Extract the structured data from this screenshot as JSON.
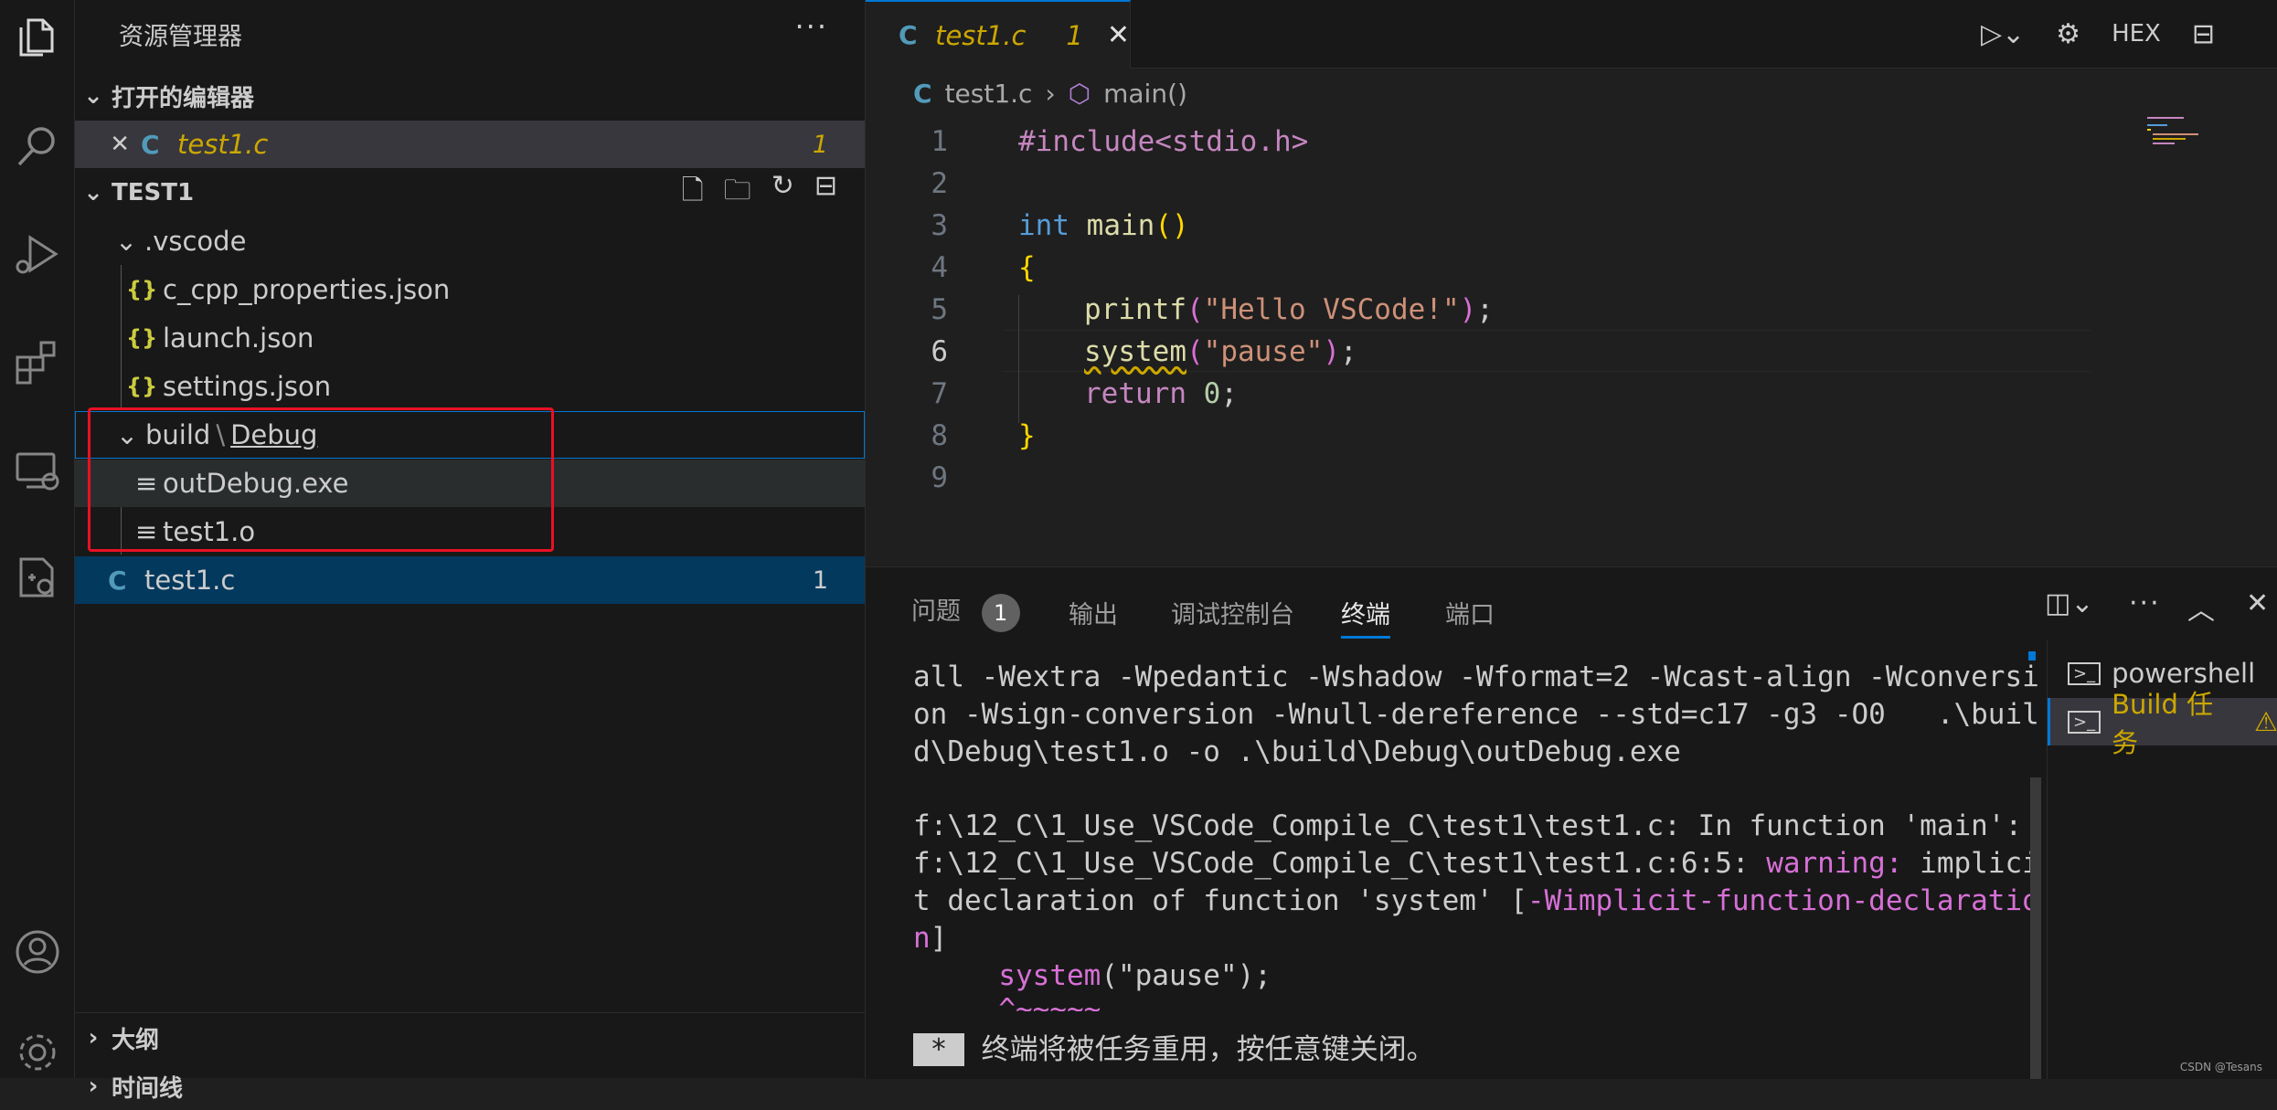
{
  "sidebar": {
    "title": "资源管理器",
    "more": "···",
    "open_editors": {
      "label": "打开的编辑器",
      "file": "test1.c",
      "badge": "1"
    },
    "project": {
      "label": "TEST1"
    },
    "tree": {
      "vscode_folder": ".vscode",
      "files": [
        "c_cpp_properties.json",
        "launch.json",
        "settings.json"
      ],
      "build_folder": "build",
      "build_sep": "\\",
      "build_sub": "Debug",
      "build_files": [
        "outDebug.exe",
        "test1.o"
      ],
      "root_file": "test1.c",
      "root_badge": "1"
    },
    "outline": "大纲",
    "timeline": "时间线"
  },
  "editor": {
    "tab": {
      "name": "test1.c",
      "badge": "1",
      "close": "✕"
    },
    "hex": "HEX",
    "breadcrumb": {
      "file": "test1.c",
      "symbol": "main()"
    },
    "line_numbers": [
      "1",
      "2",
      "3",
      "4",
      "5",
      "6",
      "7",
      "8",
      "9"
    ],
    "code": {
      "l1": "#include<stdio.h>",
      "l3_kw": "int",
      "l3_fn": "main",
      "l3_parens": "()",
      "l4": "{",
      "l5_fn": "printf",
      "l5_open": "(",
      "l5_str": "\"Hello VSCode!\"",
      "l5_close": ")",
      "l5_semi": ";",
      "l6_fn": "system",
      "l6_open": "(",
      "l6_str": "\"pause\"",
      "l6_close": ")",
      "l6_semi": ";",
      "l7_kw": "return",
      "l7_num": "0",
      "l7_semi": ";",
      "l8": "}"
    }
  },
  "panel": {
    "tabs": {
      "problems": "问题",
      "problems_count": "1",
      "output": "输出",
      "debug_console": "调试控制台",
      "terminal": "终端",
      "ports": "端口"
    },
    "terminal_lines": {
      "t1": "all -Wextra -Wpedantic -Wshadow -Wformat=2 -Wcast-align -Wconversi",
      "t2": "on -Wsign-conversion -Wnull-dereference --std=c17 -g3 -O0   .\\buil",
      "t3": "d\\Debug\\test1.o -o .\\build\\Debug\\outDebug.exe",
      "t4": "f:\\12_C\\1_Use_VSCode_Compile_C\\test1\\test1.c: In function 'main':",
      "t5a": "f:\\12_C\\1_Use_VSCode_Compile_C\\test1\\test1.c:6:5: ",
      "t5b": "warning:",
      "t5c": " implici",
      "t6a": "t declaration of function 'system' [",
      "t6b": "-Wimplicit-function-declaratio",
      "t7a": "n",
      "t7b": "]",
      "t8a": "     ",
      "t8b": "system",
      "t8c": "(\"pause\");",
      "t9": "     ^~~~~~",
      "t10_star": " * ",
      "t10": " 终端将被任务重用，按任意键关闭。"
    },
    "terminal_list": {
      "item1": "powershell",
      "item2": "Build 任务"
    }
  },
  "watermark": "CSDN @Tesans",
  "colors": {
    "accent": "#0078d4",
    "highlight_box": "#e81123",
    "warning": "#cca700"
  }
}
